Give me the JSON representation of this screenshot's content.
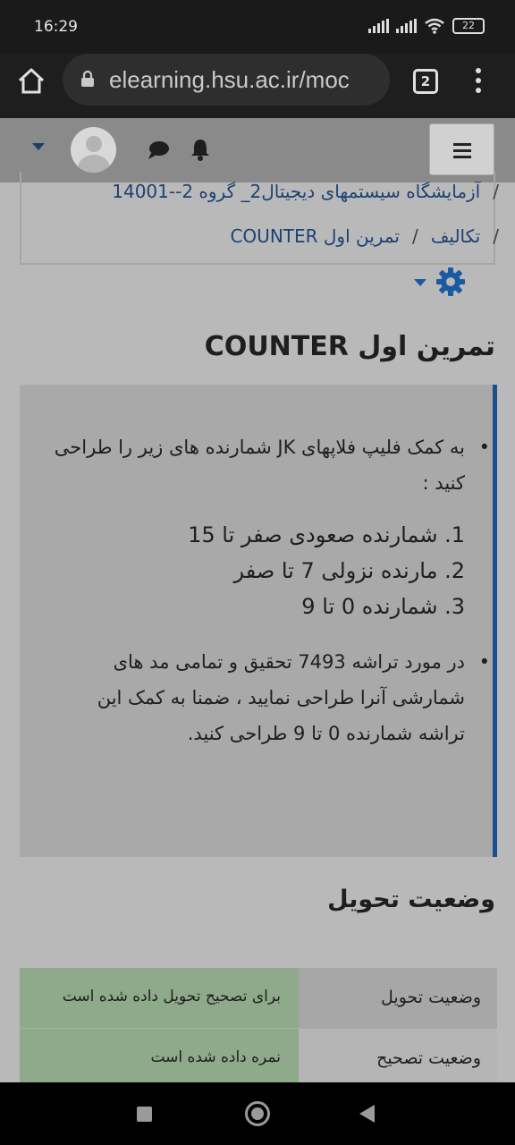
{
  "status_bar": {
    "time": "16:29",
    "battery": "22",
    "icons": [
      "signal-icon",
      "signal-icon",
      "wifi-icon",
      "battery-icon"
    ]
  },
  "browser": {
    "url": "elearning.hsu.ac.ir/moc",
    "tab_count": "2"
  },
  "breadcrumb": {
    "line1": {
      "sep": "/",
      "link": "آزمایشگاه سیستمهای دیجیتال2_ گروه 2--14001"
    },
    "line2": {
      "sep1": "/",
      "link1": "تکالیف",
      "sep2": "/",
      "link2": "تمرین اول COUNTER"
    }
  },
  "page_title": "تمرین اول COUNTER",
  "intro": {
    "bullet1": "به کمک فلیپ فلاپهای JK  شمارنده های زیر را طراحی کنید :",
    "items": [
      "1. شمارنده صعودی صفر تا 15",
      "2. مارنده نزولی 7 تا صفر",
      "3. شمارنده 0 تا 9"
    ],
    "bullet2": "در مورد تراشه 7493 تحقیق و تمامی مد های شمارشی آنرا طراحی نمایید ، ضمنا به کمک این تراشه شمارنده 0 تا 9 طراحی کنید."
  },
  "submission_status": {
    "title": "وضعیت تحویل",
    "rows": [
      {
        "label": "وضعیت تحویل",
        "value": "برای تصحیح تحویل داده شده است"
      },
      {
        "label": "وضعیت تصحیح",
        "value": "نمره داده شده است"
      }
    ]
  },
  "colors": {
    "accent": "#1b5aa1",
    "link": "#1b4272",
    "status_cell": "#8fa98b"
  }
}
